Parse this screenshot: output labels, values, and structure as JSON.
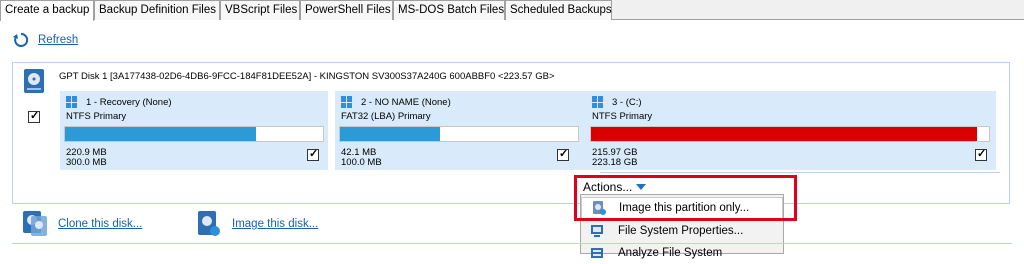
{
  "tabs": [
    {
      "label": "Create a backup",
      "active": true
    },
    {
      "label": "Backup Definition Files"
    },
    {
      "label": "VBScript Files"
    },
    {
      "label": "PowerShell Files"
    },
    {
      "label": "MS-DOS Batch Files"
    },
    {
      "label": "Scheduled Backups"
    }
  ],
  "toolbar": {
    "refresh_label": "Refresh",
    "refresh_icon": "refresh-icon"
  },
  "disk": {
    "title": "GPT Disk 1 [3A177438-02D6-4DB6-9FCC-184F81DEE52A] - KINGSTON SV300S37A240G 600ABBF0  <223.57 GB>",
    "icon": "disk-icon",
    "selected": true
  },
  "partitions": [
    {
      "name": "1 - Recovery (None)",
      "fs": "NTFS Primary",
      "used": "220.9 MB",
      "total": "300.0 MB",
      "fill_fraction": 0.74,
      "color": "#2b9ad6",
      "checked": true
    },
    {
      "name": "2 - NO NAME (None)",
      "fs": "FAT32 (LBA) Primary",
      "used": "42.1 MB",
      "total": "100.0 MB",
      "fill_fraction": 0.42,
      "color": "#2b9ad6",
      "checked": true
    },
    {
      "name": "3 -  (C:)",
      "fs": "NTFS Primary",
      "used": "215.97 GB",
      "total": "223.18 GB",
      "fill_fraction": 0.97,
      "color": "#d90000",
      "checked": true
    }
  ],
  "actions": {
    "label": "Actions...",
    "menu": [
      {
        "label": "Image this partition only...",
        "icon": "image-partition-icon"
      },
      {
        "label": "File System Properties...",
        "icon": "properties-icon"
      },
      {
        "label": "Analyze File System",
        "icon": "analyze-icon"
      }
    ]
  },
  "links": {
    "clone": "Clone this disk...",
    "image": "Image this disk..."
  },
  "colors": {
    "accent": "#1a5fb4",
    "highlight": "#e0001b",
    "partition_bg": "#d9ebfa"
  }
}
